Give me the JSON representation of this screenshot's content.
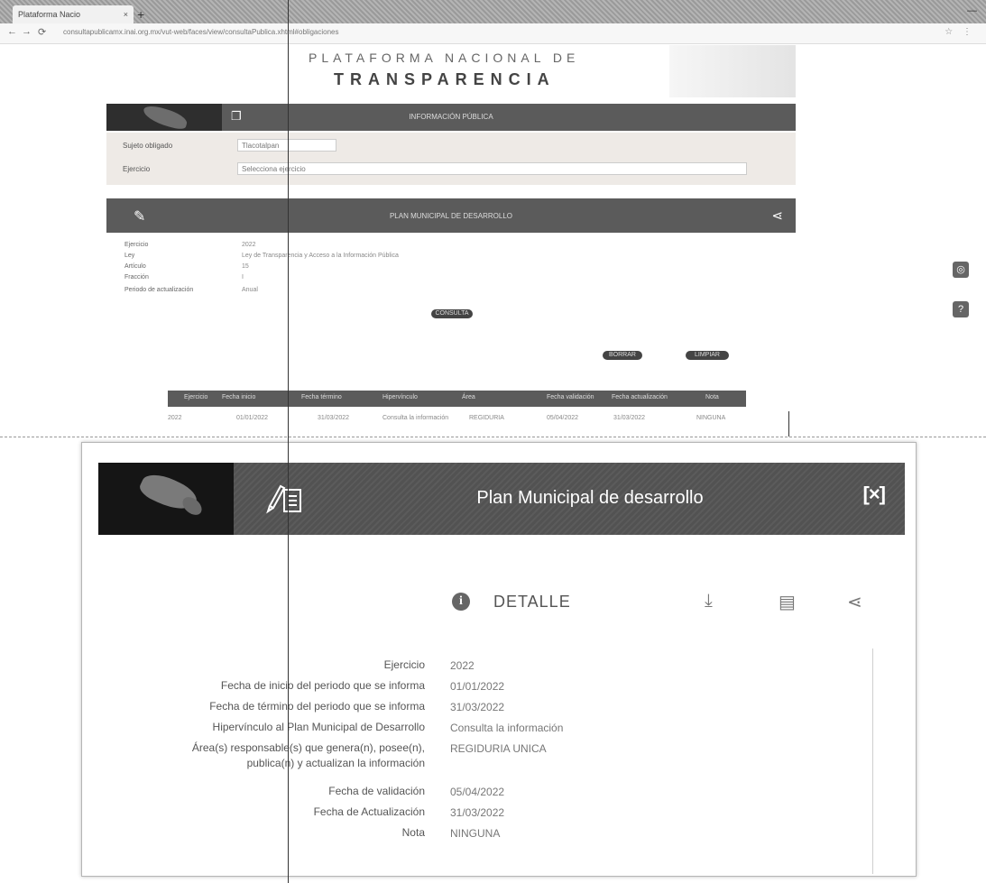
{
  "browser": {
    "tab_title": "Plataforma Nacio",
    "tab_close": "×",
    "new_tab": "+",
    "window_controls": "—",
    "back": "←",
    "forward": "→",
    "reload": "⟳",
    "url": "consultapublicamx.inai.org.mx/vut-web/faces/view/consultaPublica.xhtml#obligaciones",
    "extensions": "☆ ⋮"
  },
  "page": {
    "logo_line1": "PLATAFORMA NACIONAL DE",
    "logo_line2": "TRANSPARENCIA",
    "top_bar_title": "INFORMACIÓN PÚBLICA",
    "form": {
      "field1_label": "Sujeto obligado",
      "field1_value": "Tlacotalpan",
      "field2_label": "Ejercicio",
      "field2_value": "Selecciona ejercicio"
    },
    "section_bar_title": "PLAN MUNICIPAL DE DESARROLLO",
    "meta": [
      {
        "label": "Ejercicio",
        "value": "2022"
      },
      {
        "label": "Ley",
        "value": "Ley de Transparencia y Acceso a la Información Pública"
      },
      {
        "label": "Artículo",
        "value": "15"
      },
      {
        "label": "Fracción",
        "value": "I"
      },
      {
        "label": "Periodo de actualización",
        "value": "Anual"
      }
    ],
    "pill_1": "CONSULTA",
    "pill_2": "BORRAR",
    "pill_3": "LIMPIAR",
    "table_headers": [
      "Ejercicio",
      "Fecha inicio",
      "Fecha término",
      "Hipervínculo",
      "Área",
      "Fecha validación",
      "Fecha actualización",
      "Nota"
    ],
    "table_row": [
      "2022",
      "01/01/2022",
      "31/03/2022",
      "Consulta la información",
      "REGIDURIA",
      "05/04/2022",
      "31/03/2022",
      "NINGUNA"
    ]
  },
  "modal": {
    "title": "Plan Municipal de desarrollo",
    "close_label": "[×]",
    "detail_label": "DETALLE",
    "info_glyph": "i",
    "download_glyph": "⤓",
    "print_glyph": "▤",
    "share_glyph": "⋖",
    "fields": [
      {
        "label": "Ejercicio",
        "value": "2022"
      },
      {
        "label": "Fecha de inicio del periodo que se informa",
        "value": "01/01/2022"
      },
      {
        "label": "Fecha de término del periodo que se informa",
        "value": "31/03/2022"
      },
      {
        "label": "Hipervínculo al Plan Municipal de Desarrollo",
        "value": "Consulta la información"
      },
      {
        "label_line1": "Área(s) responsable(s) que genera(n), posee(n),",
        "label_line2": "publica(n) y actualizan la información",
        "value": "REGIDURIA UNICA"
      },
      {
        "label": "Fecha de validación",
        "value": "05/04/2022"
      },
      {
        "label": "Fecha de Actualización",
        "value": "31/03/2022"
      },
      {
        "label": "Nota",
        "value": "NINGUNA"
      }
    ]
  }
}
